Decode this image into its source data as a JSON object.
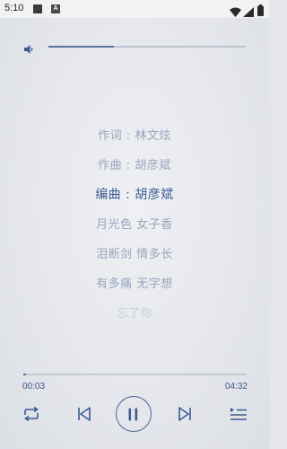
{
  "status_bar": {
    "time": "5:10",
    "a_badge": "A",
    "icons": [
      "notification-square-icon",
      "a-badge-icon",
      "wifi-icon",
      "signal-icon",
      "battery-icon"
    ]
  },
  "volume": {
    "level": 0.33
  },
  "lyrics": [
    {
      "text": "作词 : 林文炫",
      "state": "normal"
    },
    {
      "text": "作曲 : 胡彦斌",
      "state": "normal"
    },
    {
      "text": "编曲 : 胡彦斌",
      "state": "active"
    },
    {
      "text": "月光色 女子香",
      "state": "normal"
    },
    {
      "text": "泪断剑 情多长",
      "state": "normal"
    },
    {
      "text": "有多痛 无字想",
      "state": "normal"
    },
    {
      "text": "忘了你",
      "state": "fade"
    }
  ],
  "player": {
    "elapsed": "00:03",
    "total": "04:32",
    "progress": 0.011
  },
  "controls": {
    "icons": [
      "repeat-icon",
      "skip-previous-icon",
      "pause-icon",
      "skip-next-icon",
      "playlist-icon"
    ]
  },
  "colors": {
    "accent": "#3b5a92",
    "lyric_inactive": "#98a6bd",
    "background": "#e6e8ec"
  }
}
